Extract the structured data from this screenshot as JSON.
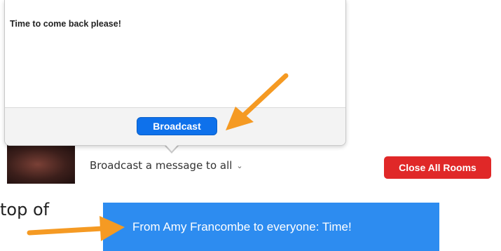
{
  "popover": {
    "message": "Time to come back please!",
    "broadcast_button": "Broadcast"
  },
  "bottom_bar": {
    "dropdown_label": "Broadcast a message to all",
    "close_all_button": "Close All Rooms"
  },
  "caption": {
    "text": "top of"
  },
  "notification": {
    "text": "From Amy Francombe to everyone: Time!"
  },
  "colors": {
    "accent_blue": "#0e71eb",
    "danger_red": "#e02828",
    "banner_blue": "#2d8cf0",
    "annotation_arrow": "#f59a23"
  },
  "icons": {
    "dropdown": "chevron-down-icon",
    "annotation": "arrow-annotation-icon"
  }
}
